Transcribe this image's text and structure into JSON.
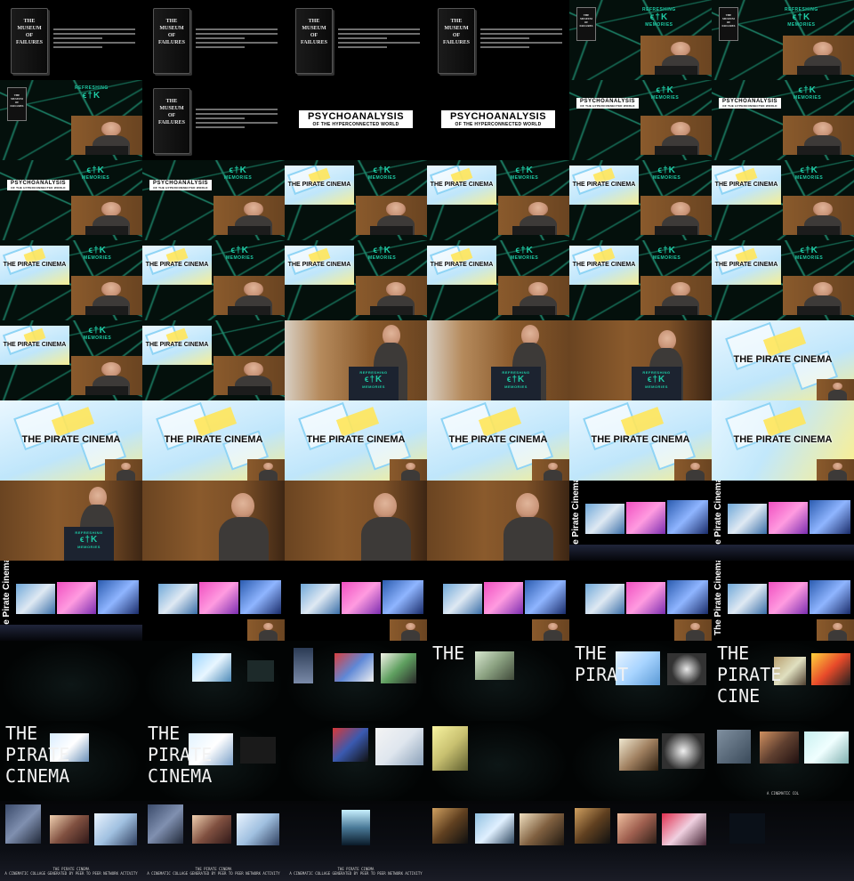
{
  "frames": {
    "book_title": "THE MUSEUM OF FAILURES",
    "ftk_big": "ϵ†K",
    "ftk_label": "REFRESHING",
    "ftk_sub": "MEMORIES",
    "psy_line1": "PSYCHOANALYSIS",
    "psy_line2": "OF THE HYPERCONNECTED WORLD",
    "pirate_title": "THE PIRATE CINEMA",
    "pirate_vertical": "The Pirate Cinema",
    "type_the": "THE",
    "type_pirat": "PIRAT",
    "type_pirate": "PIRATE",
    "type_cine": "CINE",
    "type_cinema": "CINEMA",
    "caption_line1": "THE PIRATE CINEMA",
    "caption_line2": "A CINEMATIC COLLAGE GENERATED BY PEER TO PEER NETWORK ACTIVITY",
    "caption_short": "A CINEMATIC COL"
  },
  "colors": {
    "ftk_green": "#1ec9a4",
    "web_green": "#1e8a6e",
    "pirate_yellow": "#ffe65a",
    "sky_blue": "#c2e8fb"
  }
}
